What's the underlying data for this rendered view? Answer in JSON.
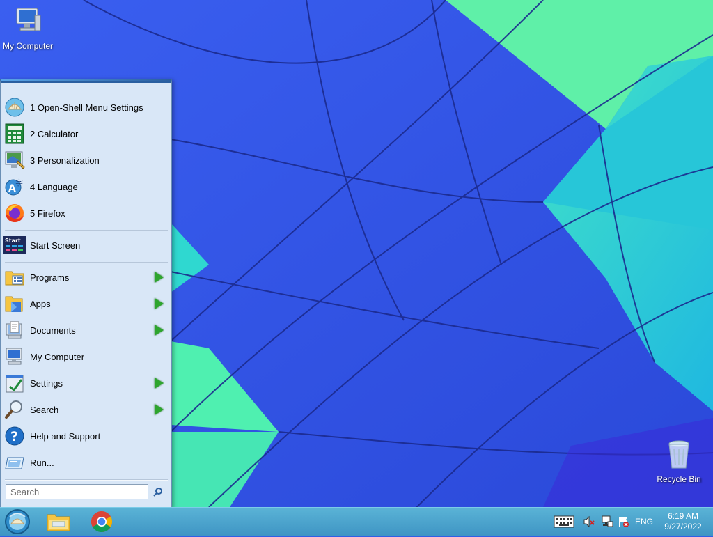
{
  "desktop": {
    "icons": [
      {
        "label": "My Computer",
        "icon": "computer-icon"
      },
      {
        "label": "Recycle Bin",
        "icon": "recycle-bin-icon"
      }
    ]
  },
  "start_menu": {
    "pinned": [
      {
        "label": "1 Open-Shell Menu Settings",
        "icon": "shell-icon"
      },
      {
        "label": "2 Calculator",
        "icon": "calculator-icon"
      },
      {
        "label": "3 Personalization",
        "icon": "personalization-icon"
      },
      {
        "label": "4 Language",
        "icon": "language-icon"
      },
      {
        "label": "5 Firefox",
        "icon": "firefox-icon"
      }
    ],
    "start_screen": {
      "label": "Start Screen",
      "icon": "start-screen-icon",
      "icon_text": "Start"
    },
    "items": [
      {
        "label": "Programs",
        "icon": "programs-icon",
        "submenu": true
      },
      {
        "label": "Apps",
        "icon": "apps-icon",
        "submenu": true
      },
      {
        "label": "Documents",
        "icon": "documents-icon",
        "submenu": true
      },
      {
        "label": "My Computer",
        "icon": "computer-icon",
        "submenu": false
      },
      {
        "label": "Settings",
        "icon": "settings-icon",
        "submenu": true
      },
      {
        "label": "Search",
        "icon": "search-icon",
        "submenu": true
      },
      {
        "label": "Help and Support",
        "icon": "help-icon",
        "submenu": false
      },
      {
        "label": "Run...",
        "icon": "run-icon",
        "submenu": false
      }
    ],
    "search": {
      "placeholder": "Search",
      "value": ""
    }
  },
  "taskbar": {
    "pinned": [
      {
        "name": "File Explorer",
        "icon": "folder-icon"
      },
      {
        "name": "Google Chrome",
        "icon": "chrome-icon"
      }
    ],
    "tray": {
      "language": "ENG",
      "time": "6:19 AM",
      "date": "9/27/2022"
    }
  },
  "colors": {
    "menu_background": "#d9e7f7",
    "taskbar": "#4aa4cf",
    "submenu_arrow": "#2ea52e",
    "wallpaper_blue": "#2f5fe6",
    "wallpaper_teal": "#35d6c4",
    "wallpaper_green": "#5ff0b0"
  }
}
